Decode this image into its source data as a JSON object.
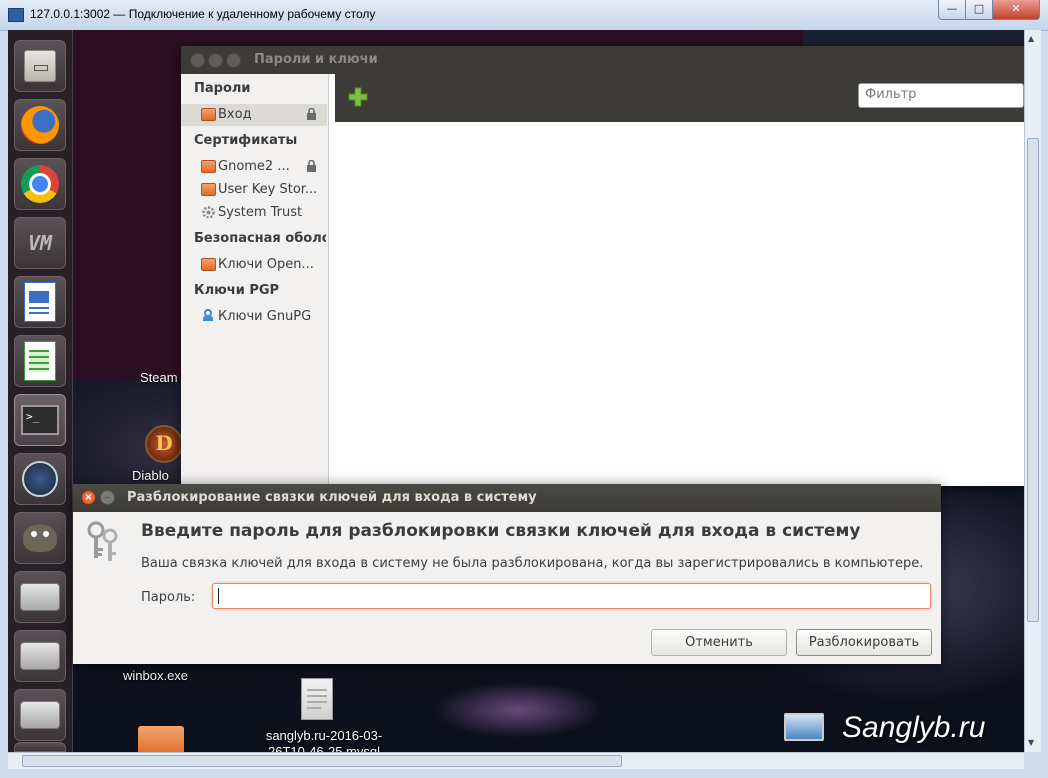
{
  "rdp_window": {
    "title": "127.0.0.1:3002 — Подключение к удаленному рабочему столу",
    "minimize_glyph": "—",
    "maximize_glyph": "□",
    "close_glyph": "✕"
  },
  "launcher": {
    "items": [
      "files-icon",
      "firefox-icon",
      "chrome-icon",
      "vmware-icon",
      "writer-icon",
      "calc-icon",
      "terminal-icon",
      "steam-icon",
      "gimp-icon",
      "drive-icon",
      "drive-icon",
      "drive-icon",
      "drive-icon"
    ]
  },
  "desktop": {
    "icons": [
      {
        "label": "Steam"
      },
      {
        "label": "Diablo"
      },
      {
        "label": "winbox.exe"
      },
      {
        "label": "sanglyb.ru-2016-03-26T10-46-25.mysql"
      }
    ],
    "watermark": "Sanglyb.ru"
  },
  "seahorse": {
    "title": "Пароли и ключи",
    "filter_placeholder": "Фильтр",
    "sidebar": {
      "passwords_header": "Пароли",
      "login_item": "Вход",
      "certificates_header": "Сертификаты",
      "gnome2_item": "Gnome2 ...",
      "userkey_item": "User Key Stor...",
      "systemtrust_item": "System Trust",
      "ssh_header": "Безопасная оболо",
      "openssh_item": "Ключи Open...",
      "pgp_header": "Ключи PGP",
      "gnupg_item": "Ключи GnuPG"
    }
  },
  "dialog": {
    "title": "Разблокирование связки ключей для входа в систему",
    "heading": "Введите пароль для разблокировки связки ключей для входа в систему",
    "message": "Ваша связка ключей для входа в систему не была разблокирована, когда вы зарегистрировались в компьютере.",
    "password_label": "Пароль:",
    "password_value": "",
    "cancel_label": "Отменить",
    "unlock_label": "Разблокировать"
  }
}
